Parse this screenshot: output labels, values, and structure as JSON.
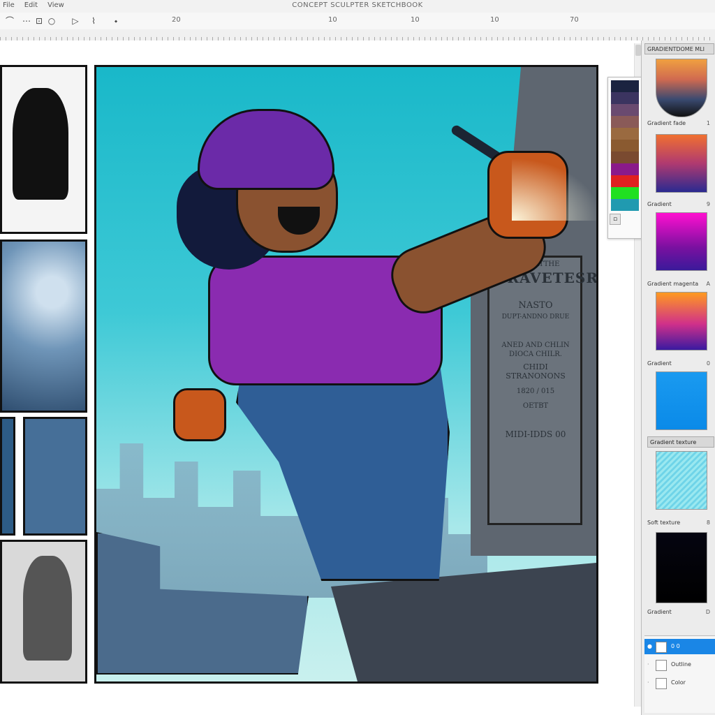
{
  "app": {
    "title": "CONCEPT SCULPTER SKETCHBOOK",
    "menu": [
      "File",
      "Edit",
      "View"
    ]
  },
  "toolbar": {
    "tools": [
      {
        "name": "brush-tool-icon",
        "glyph": "⌒"
      },
      {
        "name": "dots-icon",
        "glyph": "⋯"
      },
      {
        "name": "transform-icon",
        "glyph": "⊡"
      },
      {
        "name": "circle-icon",
        "glyph": "○"
      },
      {
        "name": "play-icon",
        "glyph": "▷"
      },
      {
        "name": "lasso-icon",
        "glyph": "⌇"
      },
      {
        "name": "fill-icon",
        "glyph": "⬩"
      }
    ],
    "fields": [
      {
        "label": "20",
        "bind": "f1"
      },
      {
        "label": "10",
        "bind": "f2"
      },
      {
        "label": "10",
        "bind": "f3"
      },
      {
        "label": "10",
        "bind": "f4"
      },
      {
        "label": "70",
        "bind": "f5"
      }
    ]
  },
  "canvas": {
    "engraving": {
      "line1": "CONDATTHE",
      "line2": "DRAVETESR",
      "line3": "NASTO",
      "line4": "DUPT-ANDNO DRUE",
      "line5": "ANED AND CHLIN",
      "line6": "DIOCA CHILR.",
      "line7": "CHIDI STRANONONS",
      "line8": "1820 / 015",
      "line9": "OETBT",
      "line10": "MIDI-IDDS 00"
    }
  },
  "swatch_colors": [
    "#1b2340",
    "#3b3460",
    "#6a4a70",
    "#8a5a58",
    "#9a6a40",
    "#8a5a30",
    "#7a4a30",
    "#8a1a8a",
    "#e02020",
    "#20e020",
    "#209ab0",
    "#3a3a9a",
    "#5a3ab0",
    "#b02a80",
    "#1a6a4a",
    "#0a4a3a"
  ],
  "right_panel": {
    "header": "GRADIENTDOME MLI",
    "presets": [
      {
        "label": "Gradient fade",
        "value": "1",
        "gradient": "linear-gradient(180deg,#f0a040 0%,#d06a50 35%,#3a4a70 70%,#111 100%)",
        "shape": "shield"
      },
      {
        "label": "Gradient",
        "value": "9",
        "gradient": "linear-gradient(180deg,#f07030 0%,#b03a70 50%,#2a2a90 100%)"
      },
      {
        "label": "Gradient magenta",
        "value": "A",
        "gradient": "linear-gradient(180deg,#ff10d0 0%,#7a10a0 60%,#3a1a9a 100%)"
      },
      {
        "label": "Gradient",
        "value": "0",
        "gradient": "linear-gradient(180deg,#ff9a20 0%,#d0308a 55%,#3a1aa0 100%)"
      },
      {
        "label": "",
        "value": "",
        "gradient": "linear-gradient(180deg,#1a9af0,#0a8ae8)"
      }
    ],
    "section2": "Gradient texture",
    "presets2": [
      {
        "label": "Soft texture",
        "value": "8",
        "gradient": "repeating-linear-gradient(135deg,#9ae8f0 0 3px,#6fd4e8 3px 6px)"
      },
      {
        "label": "Gradient",
        "value": "D",
        "gradient": "linear-gradient(180deg,#050510,#000)"
      }
    ],
    "layers": [
      {
        "name": "0 0",
        "selected": true
      },
      {
        "name": "Outline",
        "selected": false
      },
      {
        "name": "Color",
        "selected": false
      }
    ]
  }
}
